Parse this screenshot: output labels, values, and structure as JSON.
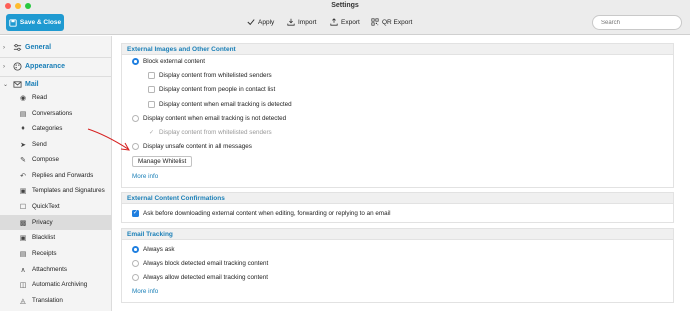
{
  "window": {
    "title": "Settings"
  },
  "toolbar": {
    "save_label": "Save & Close",
    "apply_label": "Apply",
    "import_label": "Import",
    "export_label": "Export",
    "qr_label": "QR Export",
    "search_placeholder": "Search"
  },
  "sidebar": {
    "sections": [
      {
        "label": "General",
        "icon": "sliders-icon",
        "expanded": false
      },
      {
        "label": "Appearance",
        "icon": "palette-icon",
        "expanded": false
      },
      {
        "label": "Mail",
        "icon": "envelope-icon",
        "expanded": true
      }
    ],
    "items": [
      {
        "label": "Read",
        "icon": "eye-icon"
      },
      {
        "label": "Conversations",
        "icon": "conversation-icon"
      },
      {
        "label": "Categories",
        "icon": "tag-icon"
      },
      {
        "label": "Send",
        "icon": "send-icon"
      },
      {
        "label": "Compose",
        "icon": "pencil-icon"
      },
      {
        "label": "Replies and Forwards",
        "icon": "reply-icon"
      },
      {
        "label": "Templates and Signatures",
        "icon": "template-icon"
      },
      {
        "label": "QuickText",
        "icon": "quicktext-icon"
      },
      {
        "label": "Privacy",
        "icon": "privacy-icon",
        "active": true
      },
      {
        "label": "Blacklist",
        "icon": "blacklist-icon"
      },
      {
        "label": "Receipts",
        "icon": "receipt-icon"
      },
      {
        "label": "Attachments",
        "icon": "paperclip-icon"
      },
      {
        "label": "Automatic Archiving",
        "icon": "archive-icon"
      },
      {
        "label": "Translation",
        "icon": "translate-icon"
      }
    ]
  },
  "external_images": {
    "heading": "External Images and Other Content",
    "block_label": "Block external content",
    "block_checked": true,
    "opt_whitelisted": "Display content from whitelisted senders",
    "opt_contacts": "Display content from people in contact list",
    "opt_tracking_detected": "Display content when email tracking is detected",
    "display_not_detected": "Display content when email tracking is not detected",
    "display_not_detected_sub": "Display content from whitelisted senders",
    "unsafe_label": "Display unsafe content in all messages",
    "manage_whitelist": "Manage Whitelist",
    "more_info": "More info"
  },
  "confirmations": {
    "heading": "External Content Confirmations",
    "ask_label": "Ask before downloading external content when editing, forwarding or replying to an email",
    "ask_checked": true
  },
  "tracking": {
    "heading": "Email Tracking",
    "always_ask": "Always ask",
    "always_block": "Always block detected email tracking content",
    "always_allow": "Always allow detected email tracking content",
    "selected": "Always ask",
    "more_info": "More info"
  },
  "colors": {
    "accent": "#1a7fb7",
    "button": "#1f9ad1",
    "radio_on": "#1f7fe0",
    "annotation": "#d62020"
  }
}
